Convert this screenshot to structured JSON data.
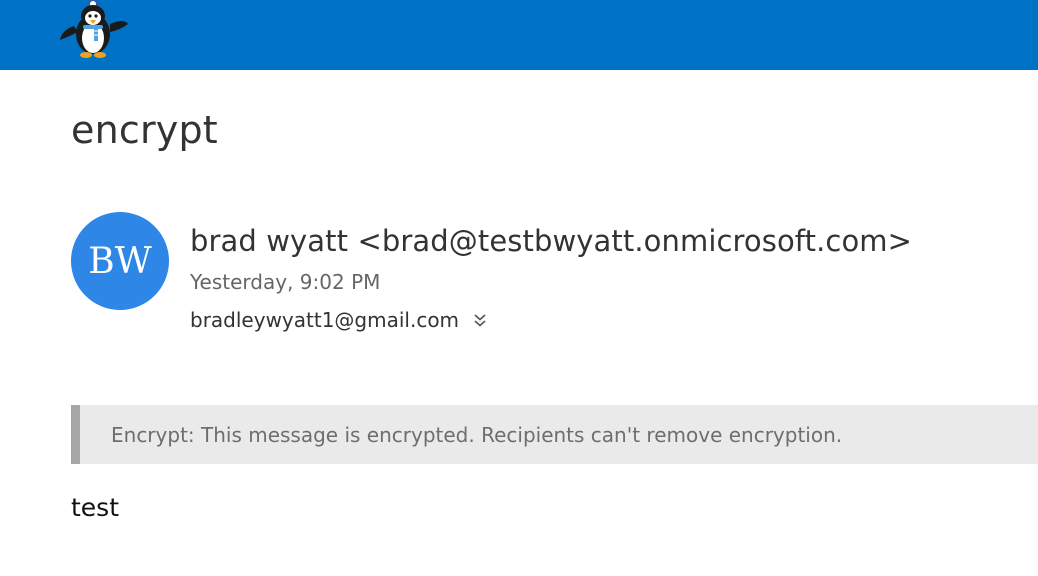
{
  "header": {
    "logo_icon": "penguin-logo-icon",
    "bar_color": "#0072c6"
  },
  "message": {
    "subject": "encrypt",
    "avatar": {
      "initials": "BW",
      "color": "#2e86e6"
    },
    "sender": "brad wyatt <brad@testbwyatt.onmicrosoft.com>",
    "timestamp": "Yesterday, 9:02 PM",
    "recipient": "bradleywyatt1@gmail.com",
    "expand_icon": "chevron-double-down-icon",
    "banner": "Encrypt: This message is encrypted. Recipients can't remove encryption.",
    "body": "test"
  }
}
